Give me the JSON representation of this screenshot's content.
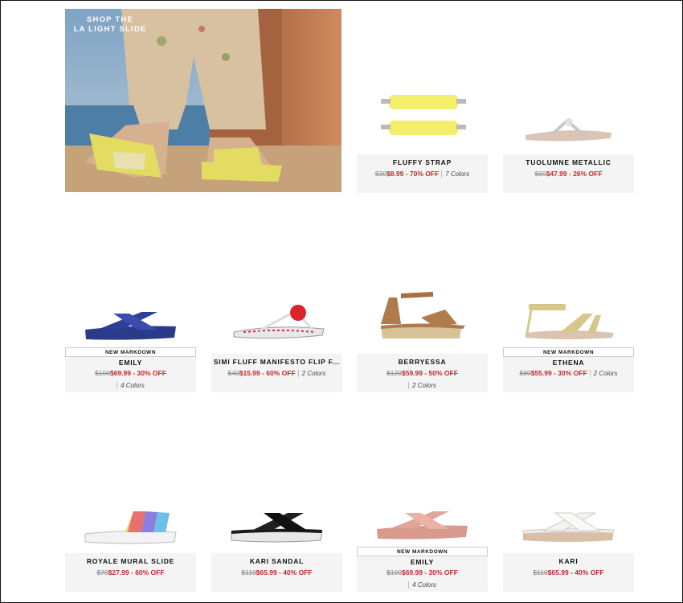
{
  "promo": {
    "line1": "SHOP THE",
    "line2": "LA LIGHT SLIDE"
  },
  "products": [
    {
      "name": "FLUFFY STRAP",
      "orig": "$30",
      "sale": "$8.99",
      "off": "70% OFF",
      "colors": "7 Colors",
      "badge": ""
    },
    {
      "name": "TUOLUMNE METALLIC",
      "orig": "$65",
      "sale": "$47.99",
      "off": "26% OFF",
      "colors": "",
      "badge": ""
    },
    {
      "name": "EMILY",
      "orig": "$100",
      "sale": "$69.99",
      "off": "30% OFF",
      "colors": "4 Colors",
      "badge": "NEW MARKDOWN"
    },
    {
      "name": "SIMI FLUFF MANIFESTO FLIP F...",
      "orig": "$40",
      "sale": "$15.99",
      "off": "60% OFF",
      "colors": "2 Colors",
      "badge": ""
    },
    {
      "name": "BERRYESSA",
      "orig": "$120",
      "sale": "$59.99",
      "off": "50% OFF",
      "colors": "2 Colors",
      "badge": ""
    },
    {
      "name": "ETHENA",
      "orig": "$80",
      "sale": "$55.99",
      "off": "30% OFF",
      "colors": "2 Colors",
      "badge": "NEW MARKDOWN"
    },
    {
      "name": "ROYALE MURAL SLIDE",
      "orig": "$70",
      "sale": "$27.99",
      "off": "60% OFF",
      "colors": "",
      "badge": ""
    },
    {
      "name": "KARI SANDAL",
      "orig": "$110",
      "sale": "$65.99",
      "off": "40% OFF",
      "colors": "",
      "badge": ""
    },
    {
      "name": "EMILY",
      "orig": "$100",
      "sale": "$69.99",
      "off": "30% OFF",
      "colors": "4 Colors",
      "badge": "NEW MARKDOWN"
    },
    {
      "name": "KARI",
      "orig": "$110",
      "sale": "$65.99",
      "off": "40% OFF",
      "colors": "",
      "badge": ""
    }
  ],
  "price_separator": " - ",
  "colors_theme": {
    "sale_red": "#c1272d",
    "card_bg": "#f4f4f4"
  }
}
